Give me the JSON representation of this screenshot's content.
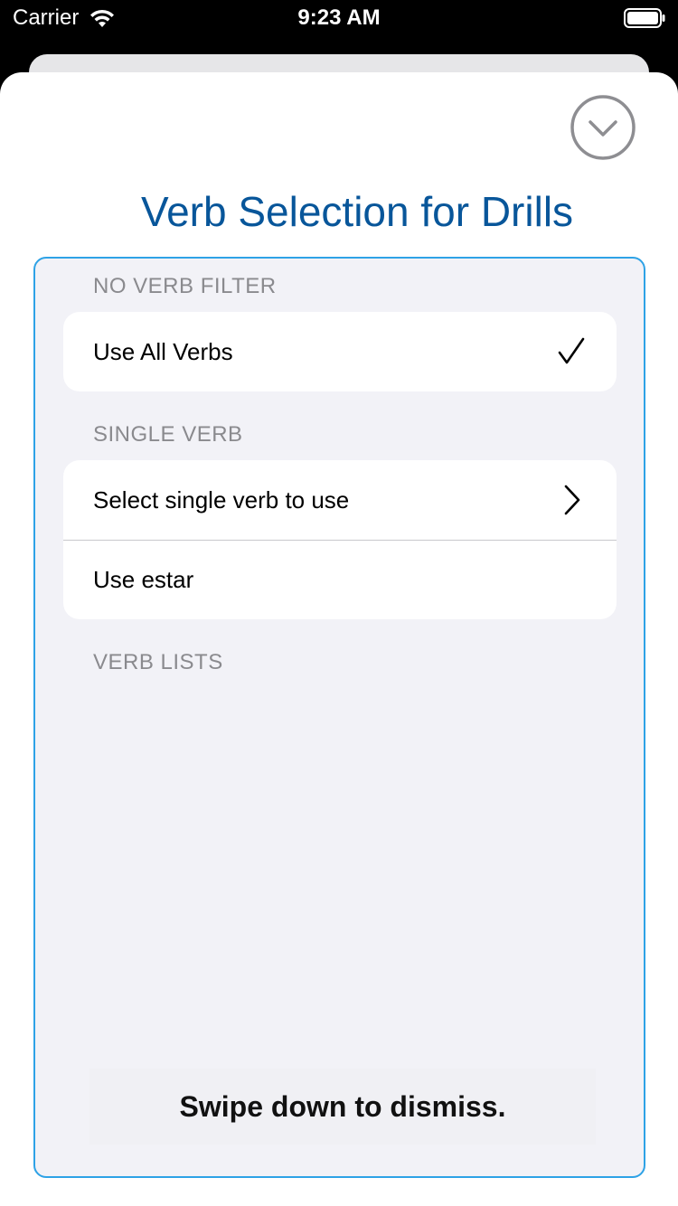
{
  "status_bar": {
    "carrier": "Carrier",
    "time": "9:23 AM",
    "icons": [
      "wifi-icon",
      "battery-icon"
    ]
  },
  "sheet": {
    "dismiss_icon": "chevron-down-circle-icon",
    "title": "Verb Selection for Drills",
    "title_color": "#08569a",
    "frame_color": "#2ea2e6"
  },
  "sections": [
    {
      "header": "NO VERB FILTER",
      "items": [
        {
          "label": "Use All Verbs",
          "accessory": "checkmark-icon",
          "selected": true
        }
      ]
    },
    {
      "header": "SINGLE VERB",
      "items": [
        {
          "label": "Select single verb to use",
          "accessory": "chevron-right-icon"
        },
        {
          "label": "Use estar",
          "accessory": ""
        }
      ]
    },
    {
      "header": "VERB LISTS",
      "items": []
    }
  ],
  "footer": {
    "hint": "Swipe down to dismiss."
  }
}
